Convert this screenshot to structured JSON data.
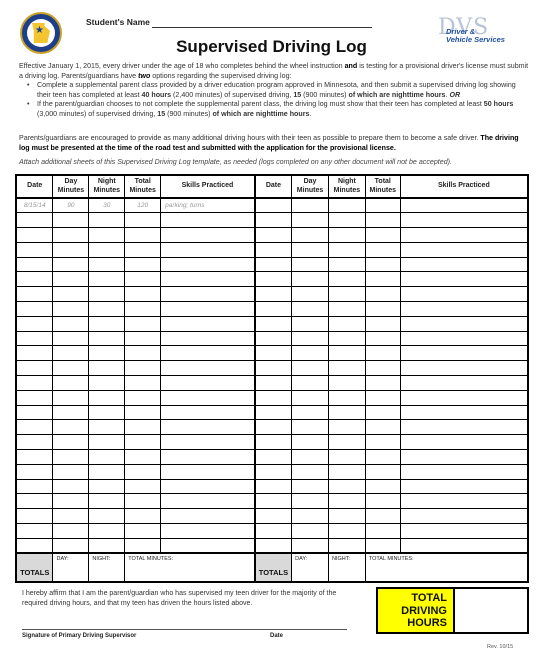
{
  "header": {
    "seal_icon": "minnesota-dps-seal-icon",
    "student_name_label": "Student's Name",
    "title": "Supervised Driving Log",
    "logo": {
      "icon": "dvs-logo-icon",
      "mark": "DVS",
      "line1": "Driver &",
      "line2": "Vehicle Services"
    }
  },
  "intro": {
    "p1_a": "Effective January 1, 2015, every driver under the age of 18 who completes behind the wheel instruction ",
    "p1_bold": "and",
    "p1_b": " is testing for a provisional driver's license must submit a driving log. Parents/guardians have ",
    "p1_two": "two",
    "p1_c": " options regarding the supervised driving log:",
    "bullet1_a": "Complete a supplemental parent class provided by a driver education program approved in Minnesota, and then submit a supervised driving log showing their teen has completed at least ",
    "bullet1_hours": "40 hours",
    "bullet1_b": " (2,400 minutes) of supervised driving, ",
    "bullet1_15": "15",
    "bullet1_c": " (900 minutes) ",
    "bullet1_night": "of which are nighttime hours",
    "bullet1_d": ". ",
    "bullet1_or": "OR",
    "bullet2_a": "If the parent/guardian chooses to not complete the supplemental parent class, the driving log must show that their teen has completed at least ",
    "bullet2_hours": "50 hours",
    "bullet2_b": " (3,000 minutes) of supervised driving, ",
    "bullet2_15": "15",
    "bullet2_c": " (900 minutes) ",
    "bullet2_night": "of which are nighttime hours",
    "bullet2_d": ".",
    "encourage_a": "Parents/guardians are encouraged to provide as many additional driving hours with their teen as possible to prepare them to become a safe driver. ",
    "encourage_bold": "The driving log must be presented at the time of the road test and submitted with the application for the provisional license.",
    "attach": "Attach additional sheets of this Supervised Driving Log template, as needed (logs completed on any other document will not be accepted)."
  },
  "table": {
    "columns": [
      "Date",
      "Day Minutes",
      "Night Minutes",
      "Total Minutes",
      "Skills Practiced"
    ],
    "sample_row": {
      "date": "8/15/14",
      "day": "90",
      "night": "30",
      "total": "120",
      "skills": "parking; turns"
    },
    "blank_rows": 23,
    "totals_label": "TOTALS",
    "totals_day": "DAY:",
    "totals_night": "NIGHT:",
    "totals_total": "TOTAL MINUTES:"
  },
  "footer": {
    "affirm": "I hereby affirm that I am the parent/guardian who has supervised my teen driver for the majority of the required driving hours, and that my teen has driven the hours listed above.",
    "signature_label": "Signature of Primary Driving Supervisor",
    "date_label": "Date",
    "total_driving_hours_label": "TOTAL DRIVING HOURS",
    "total_driving_hours_value": "",
    "highlight_color": "#ffff00",
    "revision": "Rev. 10/15"
  }
}
